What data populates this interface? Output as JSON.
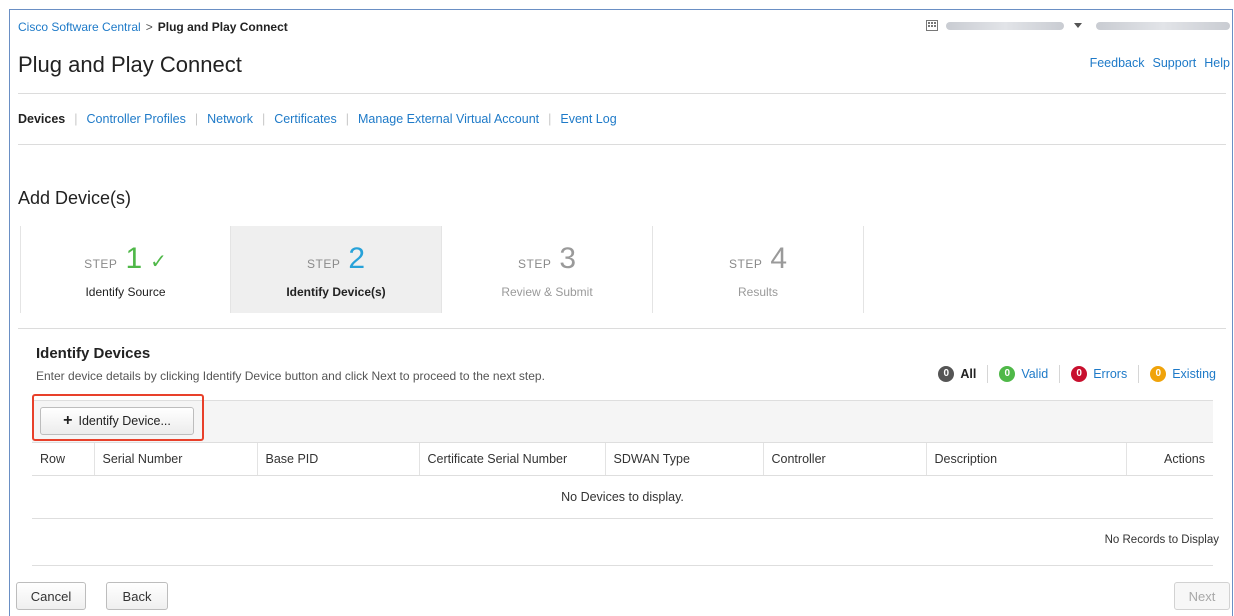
{
  "breadcrumb": {
    "home": "Cisco Software Central",
    "separator": ">",
    "current": "Plug and Play Connect"
  },
  "header": {
    "title": "Plug and Play Connect",
    "links": [
      "Feedback",
      "Support",
      "Help"
    ]
  },
  "tabs": [
    {
      "label": "Devices",
      "active": true
    },
    {
      "label": "Controller Profiles",
      "active": false
    },
    {
      "label": "Network",
      "active": false
    },
    {
      "label": "Certificates",
      "active": false
    },
    {
      "label": "Manage External Virtual Account",
      "active": false
    },
    {
      "label": "Event Log",
      "active": false
    }
  ],
  "section_title": "Add Device(s)",
  "steps": [
    {
      "prefix": "STEP",
      "number": "1",
      "check": "✓",
      "name": "Identify Source",
      "state": "done"
    },
    {
      "prefix": "STEP",
      "number": "2",
      "name": "Identify Device(s)",
      "state": "active"
    },
    {
      "prefix": "STEP",
      "number": "3",
      "name": "Review & Submit",
      "state": "pending"
    },
    {
      "prefix": "STEP",
      "number": "4",
      "name": "Results",
      "state": "pending"
    }
  ],
  "panel": {
    "title": "Identify Devices",
    "description": "Enter device details by clicking Identify Device button and click Next to proceed to the next step."
  },
  "filters": [
    {
      "count": "0",
      "label": "All",
      "color": "#555555"
    },
    {
      "count": "0",
      "label": "Valid",
      "color": "#4fb848"
    },
    {
      "count": "0",
      "label": "Errors",
      "color": "#c8102e"
    },
    {
      "count": "0",
      "label": "Existing",
      "color": "#f0a30a"
    }
  ],
  "toolbar": {
    "identify_label": "Identify Device...",
    "plus": "+"
  },
  "table": {
    "columns": [
      "Row",
      "Serial Number",
      "Base PID",
      "Certificate Serial Number",
      "SDWAN Type",
      "Controller",
      "Description",
      "Actions"
    ],
    "empty_text": "No Devices to display."
  },
  "records_text": "No Records to Display",
  "footer": {
    "cancel": "Cancel",
    "back": "Back",
    "next": "Next"
  },
  "colors": {
    "link": "#1e7ac8",
    "step_done": "#4fb848",
    "step_active": "#27a2d9",
    "highlight": "#e8402a"
  }
}
